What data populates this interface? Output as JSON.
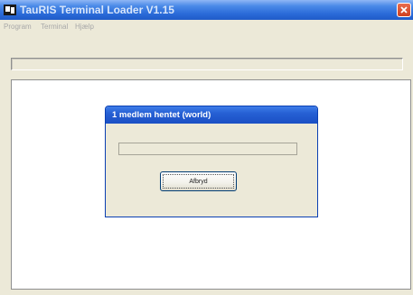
{
  "window": {
    "title": "TauRIS Terminal Loader  V1.15"
  },
  "menubar": {
    "items": [
      "Program",
      "Terminal",
      "Hjælp"
    ]
  },
  "dialog": {
    "title": "1 medlem hentet (world)",
    "cancel_label": "Afbryd"
  },
  "colors": {
    "titlebar": "#2a6ad8",
    "window_bg": "#ece9d8",
    "close_button": "#d0401e"
  },
  "icons": {
    "app": "app-icon",
    "close": "close-icon"
  }
}
